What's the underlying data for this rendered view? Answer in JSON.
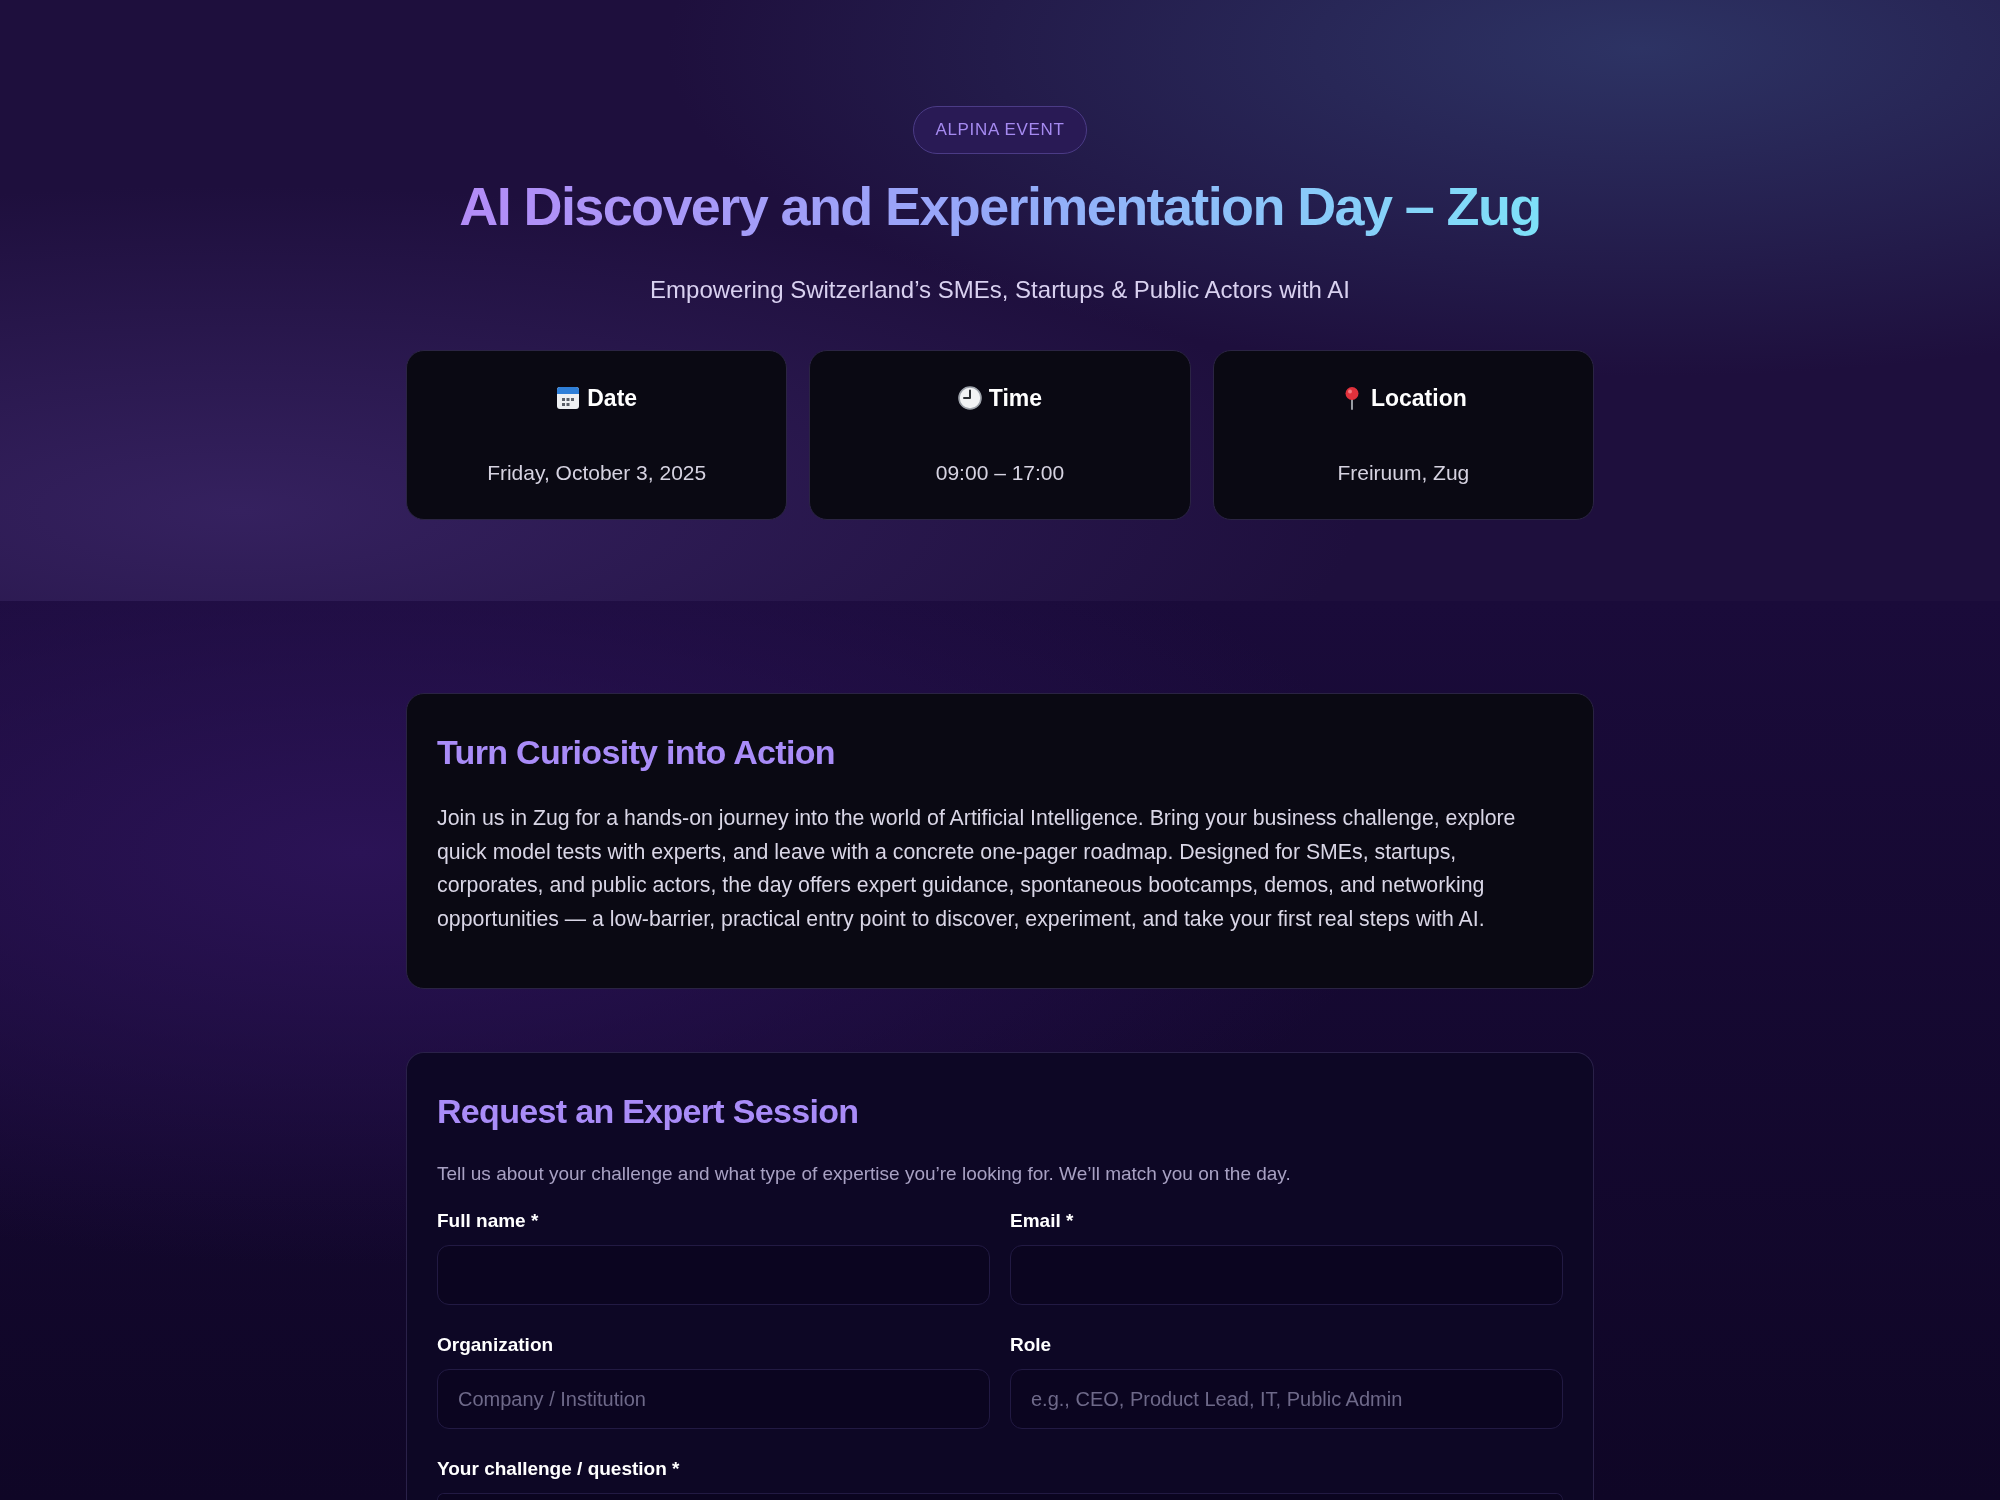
{
  "hero": {
    "badge": "ALPINA EVENT",
    "title": "AI Discovery and Experimentation Day – Zug",
    "subtitle": "Empowering Switzerland’s SMEs, Startups & Public Actors with AI",
    "info_cards": [
      {
        "kind": "date",
        "label": "Date",
        "value": "Friday, October 3, 2025"
      },
      {
        "kind": "time",
        "label": "Time",
        "value": "09:00 – 17:00"
      },
      {
        "kind": "location",
        "label": "Location",
        "value": "Freiruum, Zug"
      }
    ]
  },
  "intro": {
    "title": "Turn Curiosity into Action",
    "text": "Join us in Zug for a hands-on journey into the world of Artificial Intelligence. Bring your business challenge, explore quick model tests with experts, and leave with a concrete one-pager roadmap. Designed for SMEs, startups, corporates, and public actors, the day offers expert guidance, spontaneous bootcamps, demos, and networking opportunities — a low-barrier, practical entry point to discover, experiment, and take your first real steps with AI."
  },
  "request_form": {
    "title": "Request an Expert Session",
    "description": "Tell us about your challenge and what type of expertise you’re looking for. We’ll match you on the day.",
    "fields": [
      {
        "kind": "input",
        "label": "Full name *"
      },
      {
        "kind": "input",
        "label": "Email *"
      },
      {
        "kind": "input",
        "label": "Organization",
        "placeholder": "Company / Institution"
      },
      {
        "kind": "input",
        "label": "Role",
        "placeholder": "e.g., CEO, Product Lead, IT, Public Admin"
      },
      {
        "kind": "textarea",
        "label": "Your challenge / question *"
      }
    ]
  }
}
